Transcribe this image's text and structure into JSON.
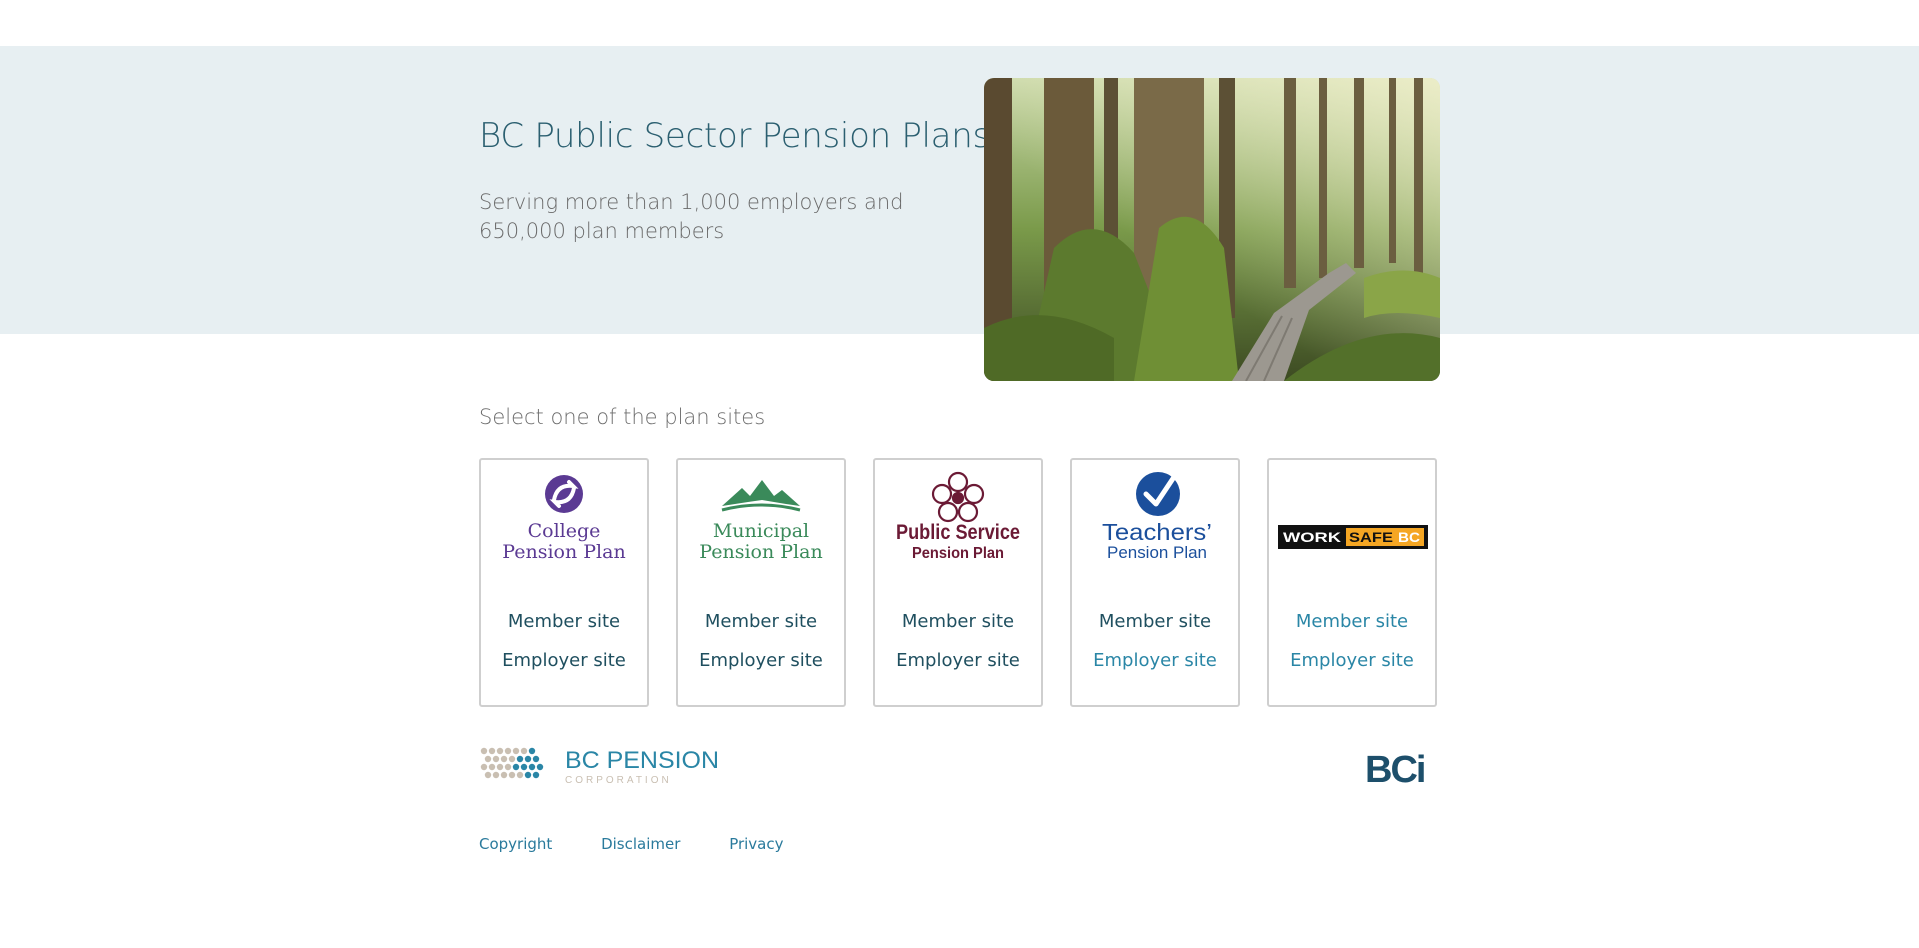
{
  "hero": {
    "title": "BC Public Sector Pension Plans",
    "subtitle": "Serving more than 1,000 employers and 650,000 plan members",
    "image": "forest-boardwalk-photo"
  },
  "plans_section": {
    "heading": "Select one of the plan sites"
  },
  "plans": [
    {
      "logo_lines": [
        "College",
        "Pension Plan"
      ],
      "logo_color": "#5b3a93",
      "logo_icon": "college-swirl-icon",
      "member_label": "Member site",
      "employer_label": "Employer site",
      "member_color": "#1f4f5f",
      "employer_color": "#1f4f5f"
    },
    {
      "logo_lines": [
        "Municipal",
        "Pension Plan"
      ],
      "logo_color": "#3a8a5a",
      "logo_icon": "mountain-icon",
      "member_label": "Member site",
      "employer_label": "Employer site",
      "member_color": "#1f4f5f",
      "employer_color": "#1f4f5f"
    },
    {
      "logo_lines": [
        "Public Service",
        "Pension Plan"
      ],
      "logo_color": "#6b1a35",
      "logo_icon": "dogwood-flower-icon",
      "member_label": "Member site",
      "employer_label": "Employer site",
      "member_color": "#1f4f5f",
      "employer_color": "#1f4f5f"
    },
    {
      "logo_lines": [
        "Teachers’",
        "Pension Plan"
      ],
      "logo_color": "#1b4f9c",
      "logo_icon": "checkmark-circle-icon",
      "member_label": "Member site",
      "employer_label": "Employer site",
      "member_color": "#1f4f5f",
      "employer_color": "#2a86a6"
    },
    {
      "logo_lines": [
        "WORK",
        "SAFE",
        "BC"
      ],
      "logo_color": "#000000",
      "logo_accent": "#f5a623",
      "logo_icon": "worksafebc-wordmark",
      "member_label": "Member site",
      "employer_label": "Employer site",
      "member_color": "#2a86a6",
      "employer_color": "#2a86a6"
    }
  ],
  "footer": {
    "bcpc_line1": "BC PENSION",
    "bcpc_line2": "CORPORATION",
    "bci": "BCi",
    "links": [
      "Copyright",
      "Disclaimer",
      "Privacy"
    ]
  },
  "colors": {
    "hero_bg": "#e7eff2",
    "title": "#2b5f70",
    "link": "#2a7a9c",
    "bci": "#1d4f6b"
  }
}
